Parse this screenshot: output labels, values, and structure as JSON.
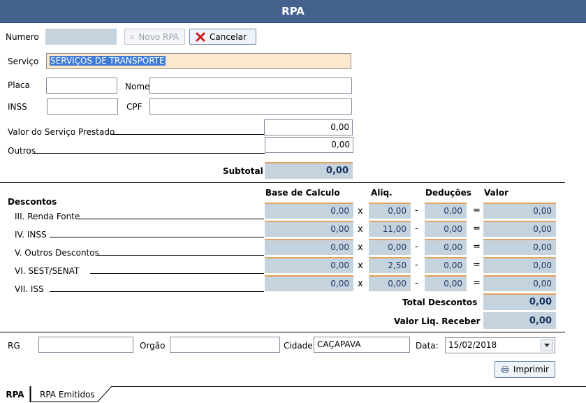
{
  "window": {
    "title": "RPA"
  },
  "header": {
    "numero_label": "Numero",
    "numero_value": "",
    "novo_label": "Novo RPA",
    "cancelar_label": "Cancelar"
  },
  "servico": {
    "label": "Serviço",
    "value": "SERVIÇOS DE TRANSPORTE"
  },
  "fields": {
    "placa_label": "Placa",
    "placa_value": "",
    "nome_label": "Nome",
    "nome_value": "",
    "inss_label": "INSS",
    "inss_value": "",
    "cpf_label": "CPF",
    "cpf_value": ""
  },
  "valores": {
    "servico_label": "Valor do Serviço Prestado",
    "servico_value": "0,00",
    "outros_label": "Outros",
    "outros_value": "0,00",
    "subtotal_label": "Subtotal",
    "subtotal_value": "0,00"
  },
  "descontos": {
    "title": "Descontos",
    "headers": {
      "base": "Base de Calculo",
      "aliq": "Aliq.",
      "deducoes": "Deduções",
      "valor": "Valor"
    },
    "ops": {
      "times": "x",
      "minus": "-",
      "equals": "="
    },
    "rows": [
      {
        "label": "III. Renda Fonte",
        "base": "0,00",
        "aliq": "0,00",
        "deducoes": "0,00",
        "valor": "0,00"
      },
      {
        "label": "IV. INSS",
        "base": "0,00",
        "aliq": "11,00",
        "deducoes": "0,00",
        "valor": "0,00"
      },
      {
        "label": "V. Outros Descontos",
        "base": "0,00",
        "aliq": "0,00",
        "deducoes": "0,00",
        "valor": "0,00"
      },
      {
        "label": "VI. SEST/SENAT",
        "base": "0,00",
        "aliq": "2,50",
        "deducoes": "0,00",
        "valor": "0,00"
      },
      {
        "label": "VII. ISS",
        "base": "0,00",
        "aliq": "0,00",
        "deducoes": "0,00",
        "valor": "0,00"
      }
    ],
    "total_label": "Total Descontos",
    "total_value": "0,00",
    "liquido_label": "Valor Liq. Receber",
    "liquido_value": "0,00"
  },
  "footer": {
    "rg_label": "RG",
    "rg_value": "",
    "orgao_label": "Orgão",
    "orgao_value": "",
    "cidade_label": "Cidade",
    "cidade_value": "CAÇAPAVA",
    "data_label": "Data:",
    "data_value": "15/02/2018",
    "imprimir_label": "Imprimir"
  },
  "tabs": [
    {
      "label": "RPA",
      "active": true
    },
    {
      "label": "RPA Emitidos",
      "active": false
    }
  ]
}
